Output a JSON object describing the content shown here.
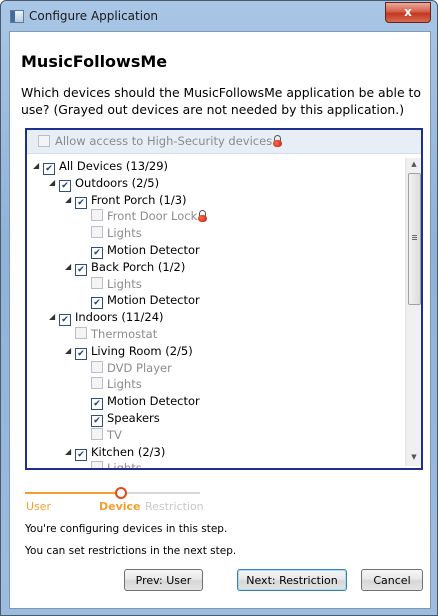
{
  "window": {
    "title": "Configure Application",
    "close_glyph": "x"
  },
  "heading": "MusicFollowsMe",
  "question": "Which devices should the MusicFollowsMe application be able to use? (Grayed out devices are not needed by this application.)",
  "high_security": {
    "label": "Allow access to High-Security devices",
    "checked": false,
    "icon": "lock-icon"
  },
  "tree": [
    {
      "label": "All Devices (13/29)",
      "level": 0,
      "expanded": true,
      "checked": true,
      "dim": false,
      "lock": false
    },
    {
      "label": "Outdoors (2/5)",
      "level": 1,
      "expanded": true,
      "checked": true,
      "dim": false,
      "lock": false
    },
    {
      "label": "Front Porch (1/3)",
      "level": 2,
      "expanded": true,
      "checked": true,
      "dim": false,
      "lock": false
    },
    {
      "label": "Front Door Lock",
      "level": 3,
      "expanded": null,
      "checked": false,
      "dim": true,
      "lock": true
    },
    {
      "label": "Lights",
      "level": 3,
      "expanded": null,
      "checked": false,
      "dim": true,
      "lock": false
    },
    {
      "label": "Motion Detector",
      "level": 3,
      "expanded": null,
      "checked": true,
      "dim": false,
      "lock": false
    },
    {
      "label": "Back Porch (1/2)",
      "level": 2,
      "expanded": true,
      "checked": true,
      "dim": false,
      "lock": false
    },
    {
      "label": "Lights",
      "level": 3,
      "expanded": null,
      "checked": false,
      "dim": true,
      "lock": false
    },
    {
      "label": "Motion Detector",
      "level": 3,
      "expanded": null,
      "checked": true,
      "dim": false,
      "lock": false
    },
    {
      "label": "Indoors (11/24)",
      "level": 1,
      "expanded": true,
      "checked": true,
      "dim": false,
      "lock": false
    },
    {
      "label": "Thermostat",
      "level": 2,
      "expanded": null,
      "checked": false,
      "dim": true,
      "lock": false
    },
    {
      "label": "Living Room (2/5)",
      "level": 2,
      "expanded": true,
      "checked": true,
      "dim": false,
      "lock": false
    },
    {
      "label": "DVD Player",
      "level": 3,
      "expanded": null,
      "checked": false,
      "dim": true,
      "lock": false
    },
    {
      "label": "Lights",
      "level": 3,
      "expanded": null,
      "checked": false,
      "dim": true,
      "lock": false
    },
    {
      "label": "Motion Detector",
      "level": 3,
      "expanded": null,
      "checked": true,
      "dim": false,
      "lock": false
    },
    {
      "label": "Speakers",
      "level": 3,
      "expanded": null,
      "checked": true,
      "dim": false,
      "lock": false
    },
    {
      "label": "TV",
      "level": 3,
      "expanded": null,
      "checked": false,
      "dim": true,
      "lock": false
    },
    {
      "label": "Kitchen (2/3)",
      "level": 2,
      "expanded": true,
      "checked": true,
      "dim": false,
      "lock": false
    },
    {
      "label": "Lights",
      "level": 3,
      "expanded": null,
      "checked": false,
      "dim": true,
      "lock": false
    }
  ],
  "steps": {
    "items": [
      "User",
      "Device",
      "Restriction"
    ],
    "current": "Device"
  },
  "info": {
    "line1": "You're configuring devices in this step.",
    "line2": "You can set restrictions in the next step."
  },
  "buttons": {
    "prev": "Prev: User",
    "next": "Next: Restriction",
    "cancel": "Cancel"
  },
  "colors": {
    "accent": "#f0a030",
    "tree_border": "#1f2f8f",
    "lock": "#c8200a",
    "dim_text": "#8c8c8c"
  }
}
